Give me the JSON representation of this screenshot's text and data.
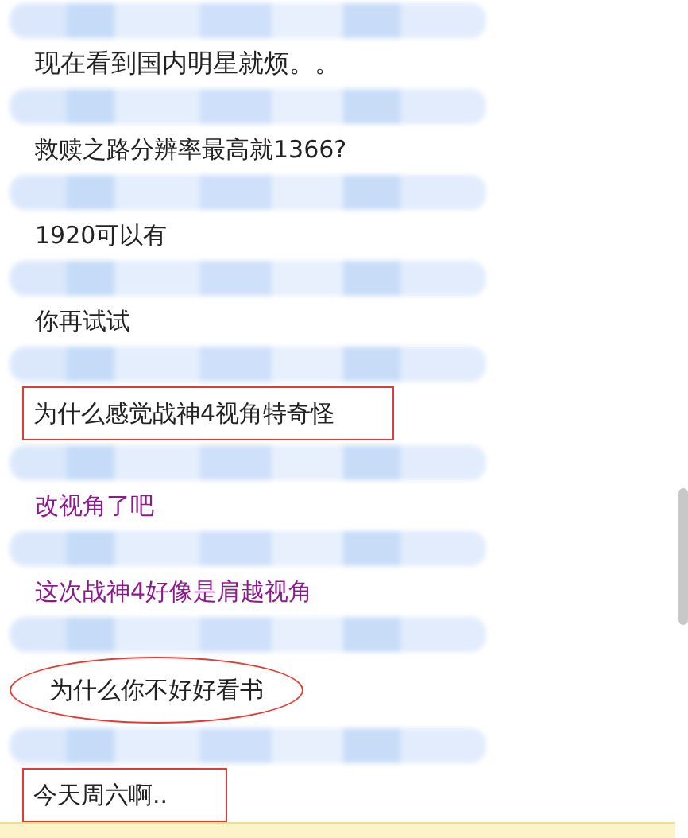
{
  "messages": [
    {
      "text": "现在看到国内明星就烦。。",
      "kind": "serif"
    },
    {
      "text": "救赎之路分辨率最高就1366?",
      "kind": "plain"
    },
    {
      "text": "1920可以有",
      "kind": "plain"
    },
    {
      "text": "你再试试",
      "kind": "plain"
    },
    {
      "text": "为什么感觉战神4视角特奇怪",
      "kind": "boxed"
    },
    {
      "text": "改视角了吧",
      "kind": "plain",
      "color": "#8b1a8b"
    },
    {
      "text": "这次战神4好像是肩越视角",
      "kind": "plain",
      "color": "#8b1a8b"
    },
    {
      "text": "为什么你不好好看书",
      "kind": "circled"
    },
    {
      "text": "今天周六啊..",
      "kind": "boxed"
    }
  ]
}
